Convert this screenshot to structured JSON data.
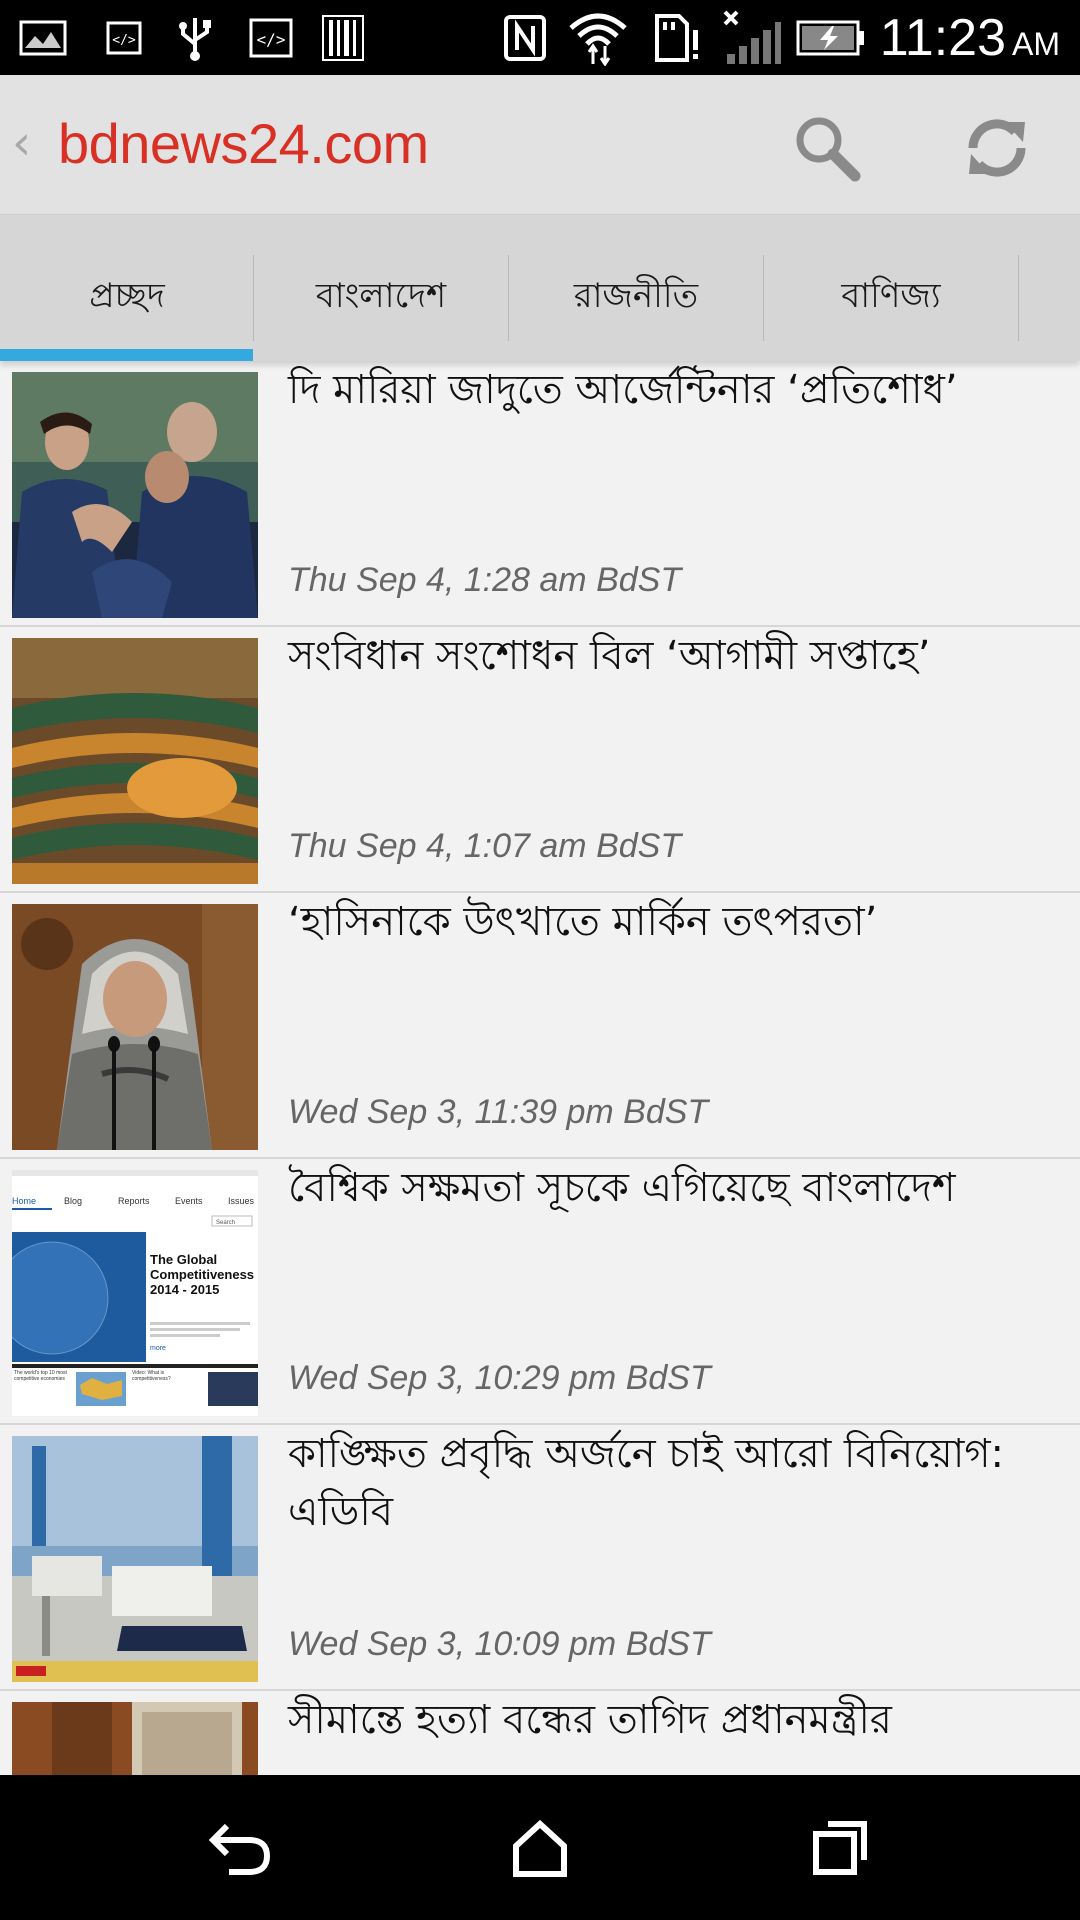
{
  "status_bar": {
    "time": "11:23",
    "ampm": "AM",
    "icons": [
      "image-notification-icon",
      "code-notification-icon",
      "usb-icon",
      "code-notification-icon",
      "barcode-icon",
      "nfc-icon",
      "wifi-icon",
      "sd-card-alert-icon",
      "signal-off-icon",
      "battery-charging-icon"
    ]
  },
  "app_bar": {
    "title": "bdnews24.com",
    "back_icon": "chevron-left-icon",
    "actions": [
      "search-icon",
      "refresh-icon"
    ]
  },
  "tabs": [
    {
      "label": "প্রচ্ছদ",
      "selected": true
    },
    {
      "label": "বাংলাদেশ",
      "selected": false
    },
    {
      "label": "রাজনীতি",
      "selected": false
    },
    {
      "label": "বাণিজ্য",
      "selected": false
    }
  ],
  "news": [
    {
      "headline": "দি মারিয়া জাদুতে আর্জেন্টিনার ‘প্রতিশোধ’",
      "time": "Thu Sep 4, 1:28 am BdST"
    },
    {
      "headline": "সংবিধান সংশোধন বিল ‘আগামী সপ্তাহে’",
      "time": "Thu Sep 4, 1:07 am BdST"
    },
    {
      "headline": "‘হাসিনাকে উৎখাতে মার্কিন তৎপরতা’",
      "time": "Wed Sep 3, 11:39 pm BdST"
    },
    {
      "headline": "বৈশ্বিক সক্ষমতা সূচকে এগিয়েছে বাংলাদেশ",
      "time": "Wed Sep 3, 10:29 pm BdST",
      "thumb_text": {
        "nav": [
          "Home",
          "Blog",
          "Reports",
          "Events",
          "Issues"
        ],
        "title": "The Global Competitiveness 2014 - 2015",
        "search": "Search",
        "more": "more",
        "caption1": "The world's top 10 most competitive economies",
        "caption2": "Video: What is competitiveness?"
      }
    },
    {
      "headline": "কাঙ্ক্ষিত প্রবৃদ্ধি অর্জনে চাই আরো বিনিয়োগ: এডিবি",
      "time": "Wed Sep 3, 10:09 pm BdST"
    },
    {
      "headline": "সীমান্তে হত্যা বন্ধের তাগিদ প্রধানমন্ত্রীর",
      "time": ""
    }
  ],
  "nav_bar": [
    "back-icon",
    "home-icon",
    "recents-icon"
  ],
  "colors": {
    "title_red": "#d93025",
    "tab_indicator": "#33a9e0",
    "appbar_bg": "#e2e2e2",
    "tabs_bg": "#d6d6d6",
    "list_bg": "#f2f2f2"
  }
}
